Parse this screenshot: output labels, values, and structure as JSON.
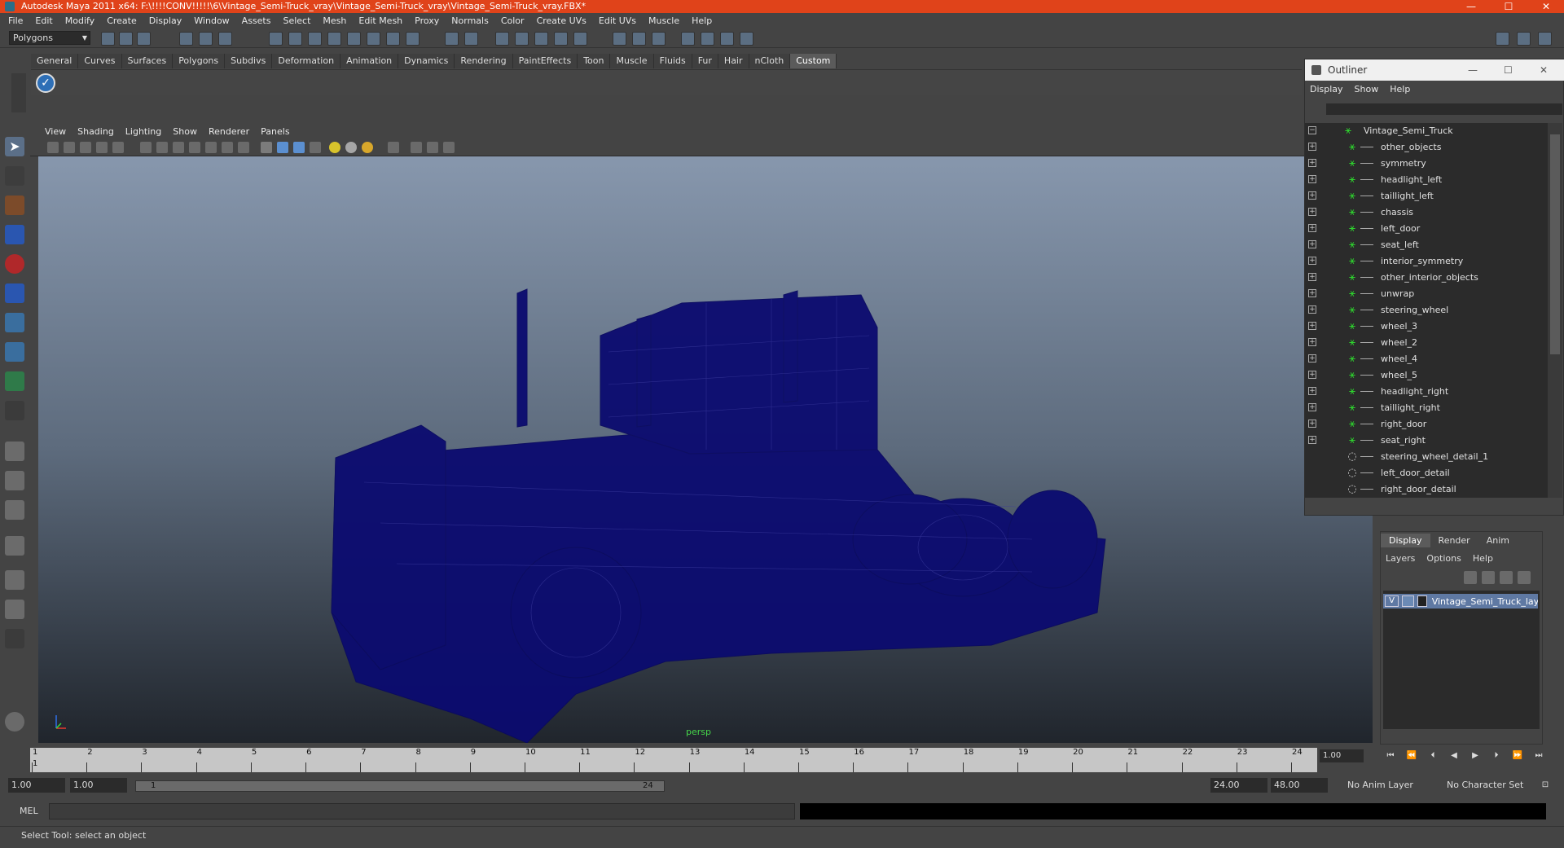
{
  "window": {
    "title": "Autodesk Maya 2011 x64: F:\\!!!!CONV!!!!!\\6\\Vintage_Semi-Truck_vray\\Vintage_Semi-Truck_vray\\Vintage_Semi-Truck_vray.FBX*"
  },
  "menubar": [
    "File",
    "Edit",
    "Modify",
    "Create",
    "Display",
    "Window",
    "Assets",
    "Select",
    "Mesh",
    "Edit Mesh",
    "Proxy",
    "Normals",
    "Color",
    "Create UVs",
    "Edit UVs",
    "Muscle",
    "Help"
  ],
  "status_line": {
    "mode": "Polygons"
  },
  "shelf": {
    "tabs": [
      "General",
      "Curves",
      "Surfaces",
      "Polygons",
      "Subdivs",
      "Deformation",
      "Animation",
      "Dynamics",
      "Rendering",
      "PaintEffects",
      "Toon",
      "Muscle",
      "Fluids",
      "Fur",
      "Hair",
      "nCloth",
      "Custom"
    ],
    "active_tab": "Custom"
  },
  "panel": {
    "menu": [
      "View",
      "Shading",
      "Lighting",
      "Show",
      "Renderer",
      "Panels"
    ],
    "camera": "persp"
  },
  "outliner": {
    "title": "Outliner",
    "menu": [
      "Display",
      "Show",
      "Help"
    ],
    "root": "Vintage_Semi_Truck",
    "items": [
      "other_objects",
      "symmetry",
      "headlight_left",
      "taillight_left",
      "chassis",
      "left_door",
      "seat_left",
      "interior_symmetry",
      "other_interior_objects",
      "unwrap",
      "steering_wheel",
      "wheel_3",
      "wheel_2",
      "wheel_4",
      "wheel_5",
      "headlight_right",
      "taillight_right",
      "right_door",
      "seat_right",
      "steering_wheel_detail_1",
      "left_door_detail",
      "right_door_detail"
    ]
  },
  "layer_editor": {
    "tabs": [
      "Display",
      "Render",
      "Anim"
    ],
    "active_tab": "Display",
    "menu": [
      "Layers",
      "Options",
      "Help"
    ],
    "layer": {
      "visible": "V",
      "name": "Vintage_Semi_Truck_laye"
    }
  },
  "timeline": {
    "ticks": [
      "1",
      "2",
      "3",
      "4",
      "5",
      "6",
      "7",
      "8",
      "9",
      "10",
      "11",
      "12",
      "13",
      "14",
      "15",
      "16",
      "17",
      "18",
      "19",
      "20",
      "21",
      "22",
      "23",
      "24"
    ],
    "current_frame_marker": "1",
    "current_time": "1.00"
  },
  "range": {
    "start_time": "1.00",
    "playback_start": "1.00",
    "slider_start": "1",
    "slider_end": "24",
    "playback_end": "24.00",
    "end_time": "48.00",
    "anim_layer": "No Anim Layer",
    "character_set": "No Character Set"
  },
  "command_line": {
    "label": "MEL"
  },
  "help_line": "Select Tool: select an object",
  "colors": {
    "title_bar": "#e0431a",
    "wireframe": "#0a0a6e",
    "outliner_icon": "#2ed12e",
    "layer_row": "#5f79a3"
  }
}
